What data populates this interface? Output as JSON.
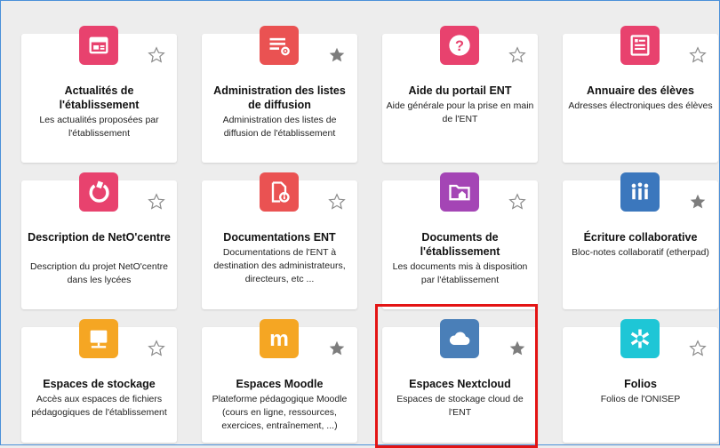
{
  "colors": {
    "pink": "#e8426e",
    "red": "#ea5252",
    "purple": "#a445b5",
    "blue": "#3b77bd",
    "orange": "#f5a623",
    "steelblue": "#4a7fb8",
    "cyan": "#1ec6d6",
    "highlight": "#e31414",
    "frame_border": "#4a90d9"
  },
  "cards": [
    {
      "title": "Actualités de l'établissement",
      "desc": "Les actualités proposées par l'établissement",
      "icon": "news-icon",
      "color": "pink",
      "favorite": false
    },
    {
      "title": "Administration des listes de diffusion",
      "desc": "Administration des listes de diffusion de l'établissement",
      "icon": "list-settings-icon",
      "color": "red",
      "favorite": true
    },
    {
      "title": "Aide du portail ENT",
      "desc": "Aide générale pour la prise en main de l'ENT",
      "icon": "help-icon",
      "color": "pink",
      "favorite": false
    },
    {
      "title": "Annuaire des élèves",
      "desc": "Adresses électroniques des élèves",
      "icon": "directory-icon",
      "color": "pink",
      "favorite": false
    },
    {
      "title": "Description de NetO'centre",
      "desc": "Description du projet NetO'centre dans les lycées",
      "icon": "netocentre-icon",
      "color": "pink",
      "favorite": false
    },
    {
      "title": "Documentations ENT",
      "desc": "Documentations de l'ENT à destination des administrateurs, directeurs, etc ...",
      "icon": "documentation-icon",
      "color": "red",
      "favorite": false
    },
    {
      "title": "Documents de l'établissement",
      "desc": "Les documents mis à disposition par l'établissement",
      "icon": "folder-home-icon",
      "color": "purple",
      "favorite": false
    },
    {
      "title": "Écriture collaborative",
      "desc": "Bloc-notes collaboratif (etherpad)",
      "icon": "collaboration-icon",
      "color": "blue",
      "favorite": true
    },
    {
      "title": "Espaces de stockage",
      "desc": "Accès aux espaces de fichiers pédagogiques de l'établissement",
      "icon": "storage-icon",
      "color": "orange",
      "favorite": false
    },
    {
      "title": "Espaces Moodle",
      "desc": "Plateforme pédagogique Moodle (cours en ligne, ressources, exercices, entraînement, ...)",
      "icon": "moodle-icon",
      "color": "orange",
      "favorite": true
    },
    {
      "title": "Espaces Nextcloud",
      "desc": "Espaces de stockage cloud de l'ENT",
      "icon": "cloud-icon",
      "color": "steelblue",
      "favorite": true
    },
    {
      "title": "Folios",
      "desc": "Folios de l'ONISEP",
      "icon": "folios-icon",
      "color": "cyan",
      "favorite": false
    }
  ]
}
